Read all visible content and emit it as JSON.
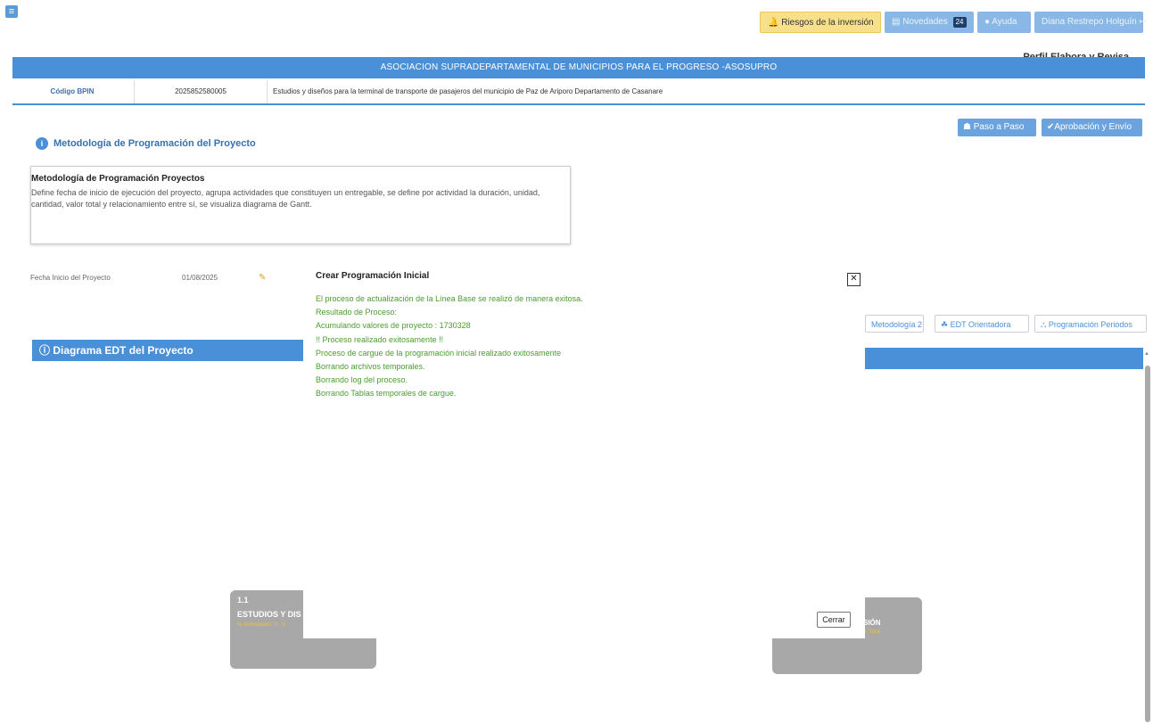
{
  "topbar": {
    "menu_icon": "hamburger-icon",
    "riesgos": "Riesgos de la inversión",
    "novedades": "Novedades",
    "novedades_count": "24",
    "ayuda": "Ayuda",
    "user": "Diana Restrepo Holguín",
    "perfil": "Perfil Elabora y Revisa"
  },
  "header": {
    "entity": "ASOCIACION SUPRADEPARTAMENTAL DE MUNICIPIOS PARA EL PROGRESO -ASOSUPRO",
    "bpin_label": "Código BPIN",
    "bpin_value": "2025852580005",
    "project_name": "Estudios y diseños para la terminal de transporte de pasajeros del municipio de Paz de Ariporo Departamento de Casanare"
  },
  "actions": {
    "paso": "Paso a Paso",
    "aprobacion": "Aprobación y Envío"
  },
  "metodologia": {
    "section_title": "Metodología de Programación del Proyecto",
    "box_title": "Metodología de Programación Proyectos",
    "box_text": "Define fecha de inicio de ejecución del proyecto, agrupa actividades que constituyen un entregable, se define por actividad la duración, unidad, cantidad, valor total y relacionamiento entre sí, se visualiza diagrama de Gantt.",
    "fecha_label": "Fecha Inicio del Proyecto",
    "fecha_value": "01/08/2025"
  },
  "tabs": [
    "Metodología 2",
    "EDT Orientadora",
    "Programación Periodos"
  ],
  "edt": {
    "title": "Diagrama EDT del Proyecto",
    "node1_num": "1.1",
    "node1_title": "ESTUDIOS Y DIS",
    "node1_sub": "N. Actividades: 1 · V",
    "node2_title": "SIÓN",
    "node2_sub": "V. Total"
  },
  "modal": {
    "title": "Crear Programación Inicial",
    "lines": [
      "El proceso de actualización de la Línea Base se realizó de manera exitosa.",
      "Resultado de Proceso:",
      "Acumulando valores de proyecto : 1730328",
      "!! Proceso realizado exitosamente !!",
      "Proceso de cargue de la programación inicial realizado exitosamente",
      "Borrando archivos temporales.",
      "Borrando log del proceso.",
      "Borrando Tablas temporales de cargue."
    ],
    "close_label": "Cerrar"
  }
}
